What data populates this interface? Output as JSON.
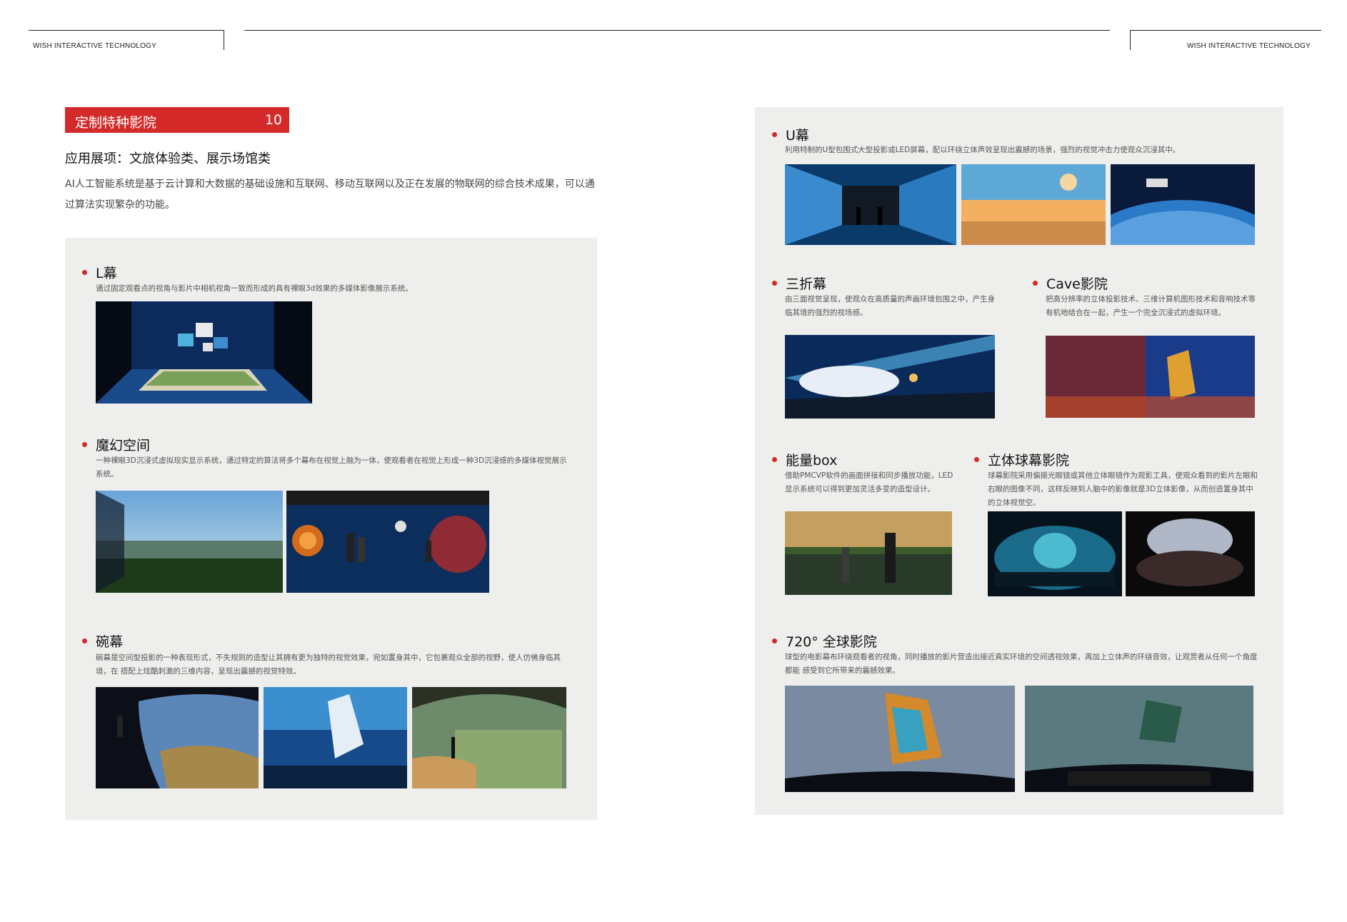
{
  "header": {
    "brand_left": "WISH INTERACTIVE TECHNOLOGY",
    "brand_right": "WISH INTERACTIVE TECHNOLOGY"
  },
  "left_page": {
    "tag_title": "定制特种影院",
    "tag_number": "10",
    "subtitle": "应用展项：文旅体验类、展示场馆类",
    "intro": "AI人工智能系统是基于云计算和大数据的基础设施和互联网、移动互联网以及正在发展的物联网的综合技术成果，可以通过算法实现繁杂的功能。",
    "sections": [
      {
        "title": "L幕",
        "desc": "通过固定观看点的视角与影片中相机视角一致而形成的具有裸眼3d效果的多媒体影像展示系统。"
      },
      {
        "title": "魔幻空间",
        "desc": "一种裸眼3D沉浸式虚拟现实显示系统，通过特定的算法将多个幕布在视觉上融为一体，使观看者在视觉上形成一种3D沉浸感的多媒体视觉展示系统。"
      },
      {
        "title": "碗幕",
        "desc": "碗幕是空间型投影的一种表现形式，不失规则的造型让其拥有更为独特的视觉效果，宛如置身其中，它包裹观众全部的视野，使人仿佛身临其境，在 搭配上炫酷刺激的三维内容，呈现出震撼的视觉特效。"
      }
    ]
  },
  "right_page": {
    "sections": [
      {
        "title": "U幕",
        "desc": "利用特制的U型包围式大型投影或LED屏幕，配以环绕立体声效呈现出震撼的场景，强烈的视觉冲击力使观众沉浸其中。"
      },
      {
        "title": "三折幕",
        "desc": "由三面视觉呈现，使观众在高质量的声画环境包围之中，产生身临其境的强烈的视场感。"
      },
      {
        "title": "Cave影院",
        "desc": "把高分辨率的立体投影技术、三维计算机图形技术和音响技术等有机地结合在一起，产生一个完全沉浸式的虚拟环境。"
      },
      {
        "title": "能量box",
        "desc": "借助PMCVP软件的画面拼接和同步播放功能，LED显示系统可以得到更加灵活多变的造型设计。"
      },
      {
        "title": "立体球幕影院",
        "desc": "球幕影院采用偏振光眼镜或其他立体眼镜作为观影工具，使观众看到的影片左眼和右眼的图像不同，这样反映到人脑中的影像就是3D立体影像，从而创造置身其中的立体视觉空。"
      },
      {
        "title": "720° 全球影院",
        "desc": "球型的电影幕布环绕观看者的视角，同时播放的影片营造出接近真实环境的空间透视效果，再加上立体声的环绕音效，让观赏者从任何一个角度都能 感受到它所带来的震撼效果。"
      }
    ]
  },
  "colors": {
    "accent": "#d42a2a",
    "panel": "#eeeeec"
  }
}
